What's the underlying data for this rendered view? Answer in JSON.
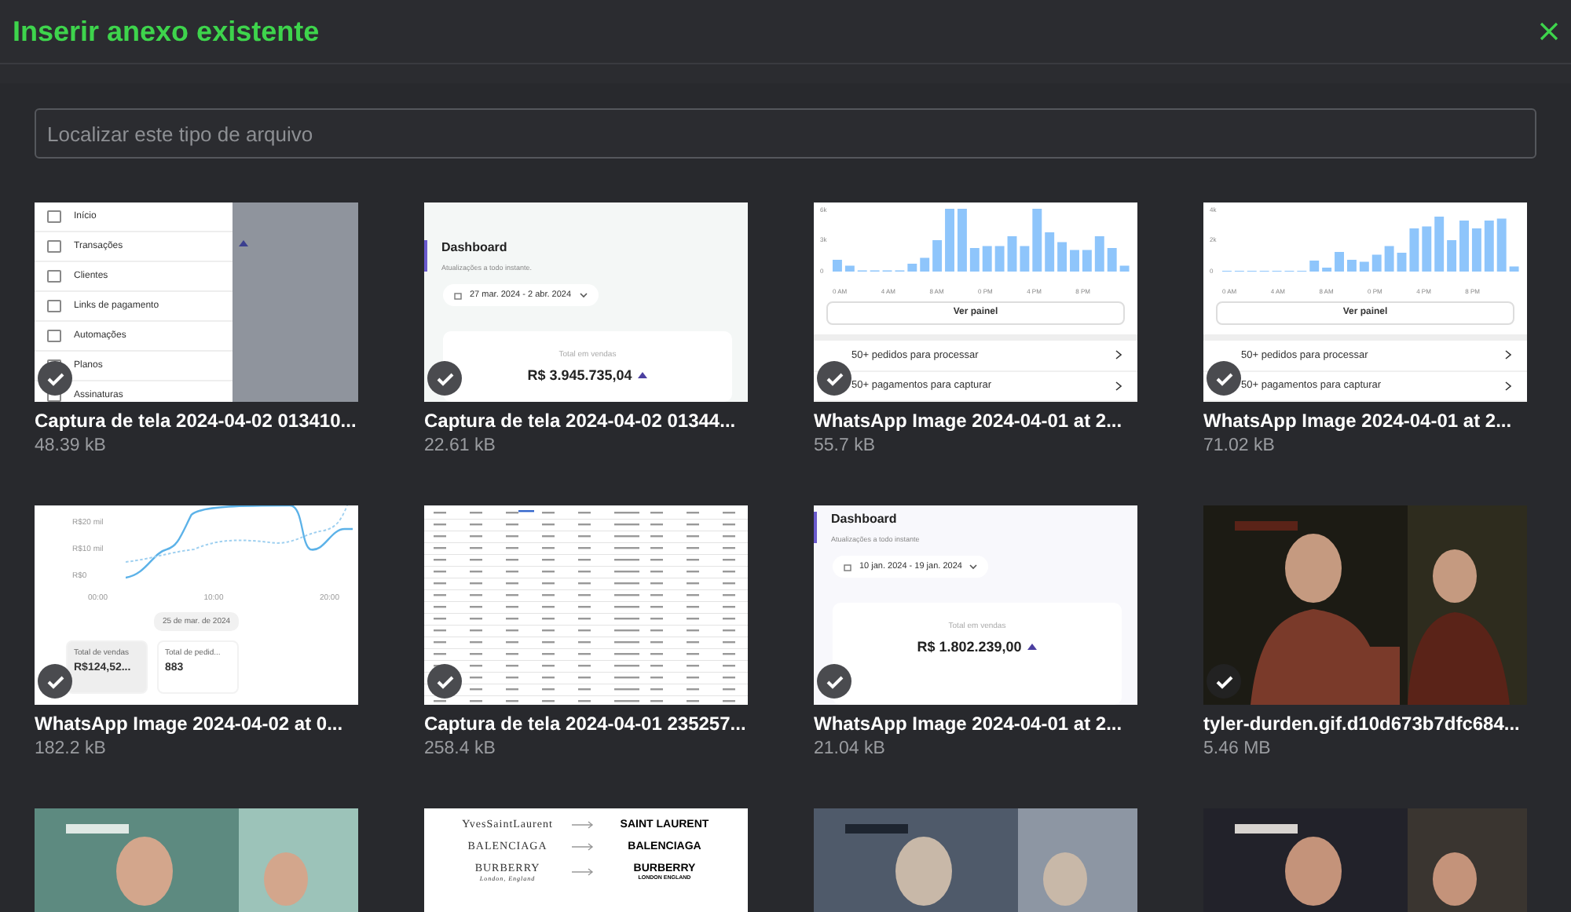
{
  "dialog": {
    "title": "Inserir anexo existente"
  },
  "search": {
    "placeholder": "Localizar este tipo de arquivo"
  },
  "files": [
    {
      "name": "Captura de tela 2024-04-02 013410...",
      "size": "48.39 kB",
      "selected": true,
      "thumbnail": {
        "kind": "sidebar",
        "items": [
          "Início",
          "Transações",
          "Clientes",
          "Links de pagamento",
          "Automações",
          "Planos",
          "Assinaturas"
        ]
      }
    },
    {
      "name": "Captura de tela 2024-04-02 01344...",
      "size": "22.61 kB",
      "selected": true,
      "thumbnail": {
        "kind": "dashboard",
        "title": "Dashboard",
        "subtitle": "Atualizações a todo instante.",
        "date_range": "27 mar. 2024 - 2 abr. 2024",
        "card_label": "Total em vendas",
        "card_value": "R$ 3.945.735,04"
      }
    },
    {
      "name": "WhatsApp Image 2024-04-01 at 2...",
      "size": "55.7 kB",
      "selected": true,
      "thumbnail": {
        "kind": "barchart",
        "yticks": [
          "6k",
          "3k",
          "0"
        ],
        "xticks": [
          "0 AM",
          "4 AM",
          "8 AM",
          "0 PM",
          "4 PM",
          "8 PM"
        ],
        "button": "Ver painel",
        "rows": [
          "50+ pedidos para processar",
          "50+ pagamentos para capturar"
        ]
      }
    },
    {
      "name": "WhatsApp Image 2024-04-01 at 2...",
      "size": "71.02 kB",
      "selected": true,
      "thumbnail": {
        "kind": "barchart",
        "yticks": [
          "4k",
          "2k",
          "0"
        ],
        "xticks": [
          "0 AM",
          "4 AM",
          "8 AM",
          "0 PM",
          "4 PM",
          "8 PM"
        ],
        "button": "Ver painel",
        "rows": [
          "50+ pedidos para processar",
          "50+ pagamentos para capturar"
        ]
      }
    },
    {
      "name": "WhatsApp Image 2024-04-02 at 0...",
      "size": "182.2 kB",
      "selected": true,
      "thumbnail": {
        "kind": "linechart",
        "yticks": [
          "R$20 mil",
          "R$10 mil",
          "R$0"
        ],
        "xticks": [
          "00:00",
          "10:00",
          "20:00"
        ],
        "date": "25 de mar. de 2024",
        "cards": [
          {
            "label": "Total de vendas",
            "value": "R$124,52..."
          },
          {
            "label": "Total de pedid...",
            "value": "883"
          }
        ]
      }
    },
    {
      "name": "Captura de tela 2024-04-01 235257...",
      "size": "258.4 kB",
      "selected": true,
      "thumbnail": {
        "kind": "table"
      }
    },
    {
      "name": "WhatsApp Image 2024-04-01 at 2...",
      "size": "21.04 kB",
      "selected": true,
      "thumbnail": {
        "kind": "dashboard",
        "title": "Dashboard",
        "subtitle": "Atualizações a todo instante",
        "date_range": "10 jan. 2024 - 19 jan. 2024",
        "card_label": "Total em vendas",
        "card_value": "R$ 1.802.239,00"
      }
    },
    {
      "name": "tyler-durden.gif.d10d673b7dfc684...",
      "size": "5.46 MB",
      "selected": true,
      "thumbnail": {
        "kind": "picture"
      }
    },
    {
      "thumbnail": {
        "kind": "picture"
      }
    },
    {
      "thumbnail": {
        "kind": "logos",
        "rows": [
          {
            "from": "YvesSaintLaurent",
            "to": "SAINT LAURENT"
          },
          {
            "from": "BALENCIAGA",
            "to": "BALENCIAGA"
          },
          {
            "from": "BURBERRY",
            "from_sub": "London, England",
            "to": "BURBERRY",
            "to_sub": "LONDON ENGLAND"
          }
        ]
      }
    },
    {
      "thumbnail": {
        "kind": "picture"
      }
    },
    {
      "thumbnail": {
        "kind": "picture"
      }
    }
  ]
}
